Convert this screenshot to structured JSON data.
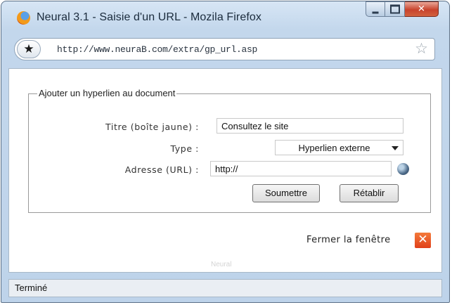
{
  "window": {
    "title": "Neural 3.1 - Saisie d'un URL - Mozila Firefox",
    "controls": {
      "minimize": "minimize-icon",
      "maximize": "maximize-icon",
      "close": "close-icon"
    }
  },
  "urlbar": {
    "url": "http://www.neuraB.com/extra/gp_url.asp",
    "identity_icon": "star-icon",
    "bookmark_icon": "bookmark-star-icon"
  },
  "form": {
    "legend": "Ajouter un hyperlien au document",
    "title_label": "Titre (boîte jaune) :",
    "title_value": "Consultez le site",
    "type_label": "Type :",
    "type_value": "Hyperlien externe",
    "address_label": "Adresse (URL) :",
    "address_value": "http://",
    "submit_label": "Soumettre",
    "reset_label": "Rétablir"
  },
  "close_window": {
    "label": "Fermer la fenêtre",
    "icon": "close-icon"
  },
  "footer": {
    "mark": "Neural"
  },
  "status": {
    "text": "Terminé"
  },
  "colors": {
    "accent_close": "#e0401a",
    "titlebar": "#c3d7ec"
  }
}
